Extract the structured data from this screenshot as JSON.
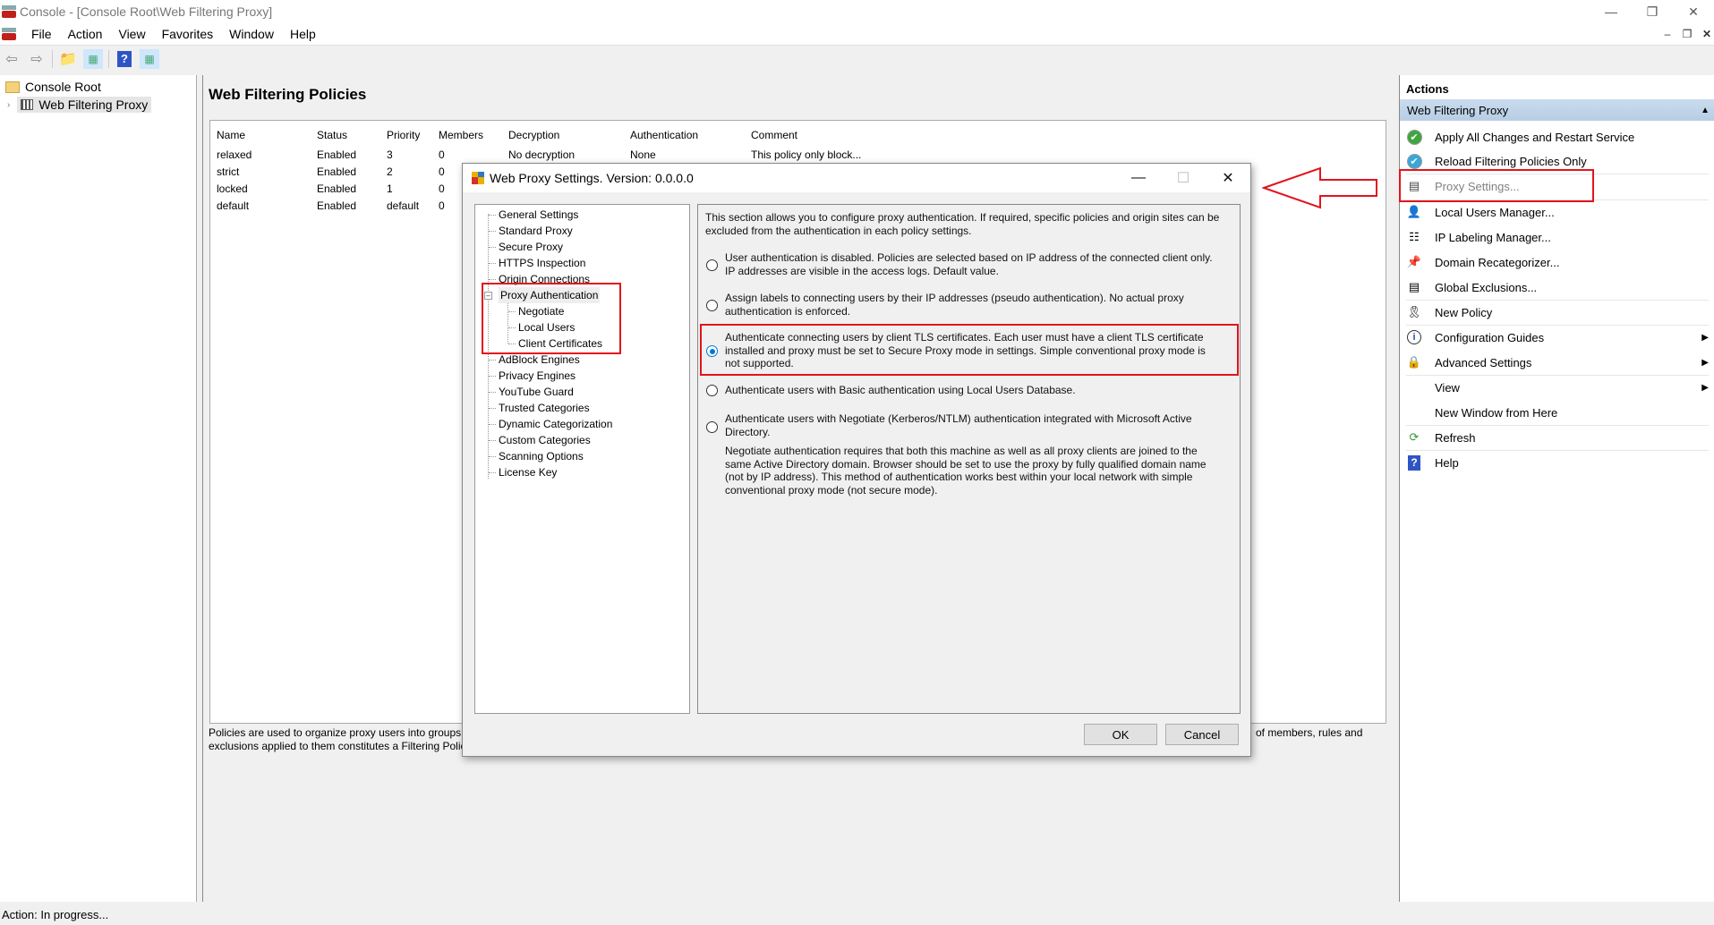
{
  "window": {
    "title": "Console - [Console Root\\Web Filtering Proxy]",
    "controls": [
      "minimize",
      "restore",
      "close"
    ]
  },
  "menu": {
    "items": [
      "File",
      "Action",
      "View",
      "Favorites",
      "Window",
      "Help"
    ]
  },
  "toolbar": {
    "buttons": [
      "back",
      "forward",
      "up-folder",
      "show-hide-console-tree",
      "help",
      "show-hide-action-pane"
    ]
  },
  "tree": {
    "root": "Console Root",
    "child": "Web Filtering Proxy"
  },
  "center": {
    "title": "Web Filtering Policies",
    "columns": [
      "Name",
      "Status",
      "Priority",
      "Members",
      "Decryption",
      "Authentication",
      "Comment"
    ],
    "rows": [
      [
        "relaxed",
        "Enabled",
        "3",
        "0",
        "No decryption",
        "None",
        "This policy only block..."
      ],
      [
        "strict",
        "Enabled",
        "2",
        "0",
        "",
        "",
        ""
      ],
      [
        "locked",
        "Enabled",
        "1",
        "0",
        "",
        "",
        ""
      ],
      [
        "default",
        "Enabled",
        "default",
        "0",
        "",
        "",
        ""
      ]
    ],
    "footer_left_line1": "Policies are used to organize proxy users into groups (",
    "footer_left_line2": "exclusions applied to them constitutes a Filtering Polic",
    "footer_right": "of members, rules and"
  },
  "actions": {
    "header": "Actions",
    "section": "Web Filtering Proxy",
    "items": [
      {
        "label": "Apply All Changes and Restart Service",
        "icon": "green-check-icon"
      },
      {
        "label": "Reload Filtering Policies Only",
        "icon": "blue-check-icon"
      },
      {
        "label": "Proxy Settings...",
        "icon": "settings-list-icon",
        "disabled": true
      },
      {
        "label": "Local Users Manager...",
        "icon": "user-icon"
      },
      {
        "label": "IP Labeling Manager...",
        "icon": "network-icon"
      },
      {
        "label": "Domain Recategorizer...",
        "icon": "pin-icon"
      },
      {
        "label": "Global Exclusions...",
        "icon": "exclusions-icon"
      },
      {
        "label": "New Policy",
        "icon": "ribbon-icon"
      },
      {
        "label": "Configuration Guides",
        "icon": "info-icon",
        "submenu": true
      },
      {
        "label": "Advanced Settings",
        "icon": "lock-icon",
        "submenu": true
      },
      {
        "label": "View",
        "icon": "",
        "submenu": true
      },
      {
        "label": "New Window from Here",
        "icon": ""
      },
      {
        "label": "Refresh",
        "icon": "refresh-icon"
      },
      {
        "label": "Help",
        "icon": "help-icon"
      }
    ]
  },
  "status": {
    "text": "Action:  In progress..."
  },
  "dialog": {
    "title": "Web Proxy Settings. Version: 0.0.0.0",
    "nav": [
      "General Settings",
      "Standard Proxy",
      "Secure Proxy",
      "HTTPS Inspection",
      "Origin Connections",
      "Proxy Authentication",
      "Negotiate",
      "Local Users",
      "Client Certificates",
      "AdBlock Engines",
      "Privacy Engines",
      "YouTube Guard",
      "Trusted Categories",
      "Dynamic Categorization",
      "Custom Categories",
      "Scanning Options",
      "License Key"
    ],
    "intro": "This section allows you to configure proxy authentication.  If required, specific policies and origin sites can be excluded from the authentication in each policy settings.",
    "options": [
      {
        "text": "User authentication is disabled. Policies are selected based on IP address of the connected client only. IP addresses are visible in the access logs. Default value.",
        "selected": false
      },
      {
        "text": "Assign labels to connecting users by their IP addresses (pseudo authentication). No actual proxy authentication is enforced.",
        "selected": false
      },
      {
        "text": "Authenticate connecting users by client TLS certificates. Each user must have a client TLS certificate installed and proxy must be set to Secure Proxy mode in settings. Simple conventional proxy mode is not supported.",
        "selected": true
      },
      {
        "text": "Authenticate users with Basic authentication using Local Users Database.",
        "selected": false
      },
      {
        "text": "Authenticate users with Negotiate (Kerberos/NTLM) authentication integrated with Microsoft Active Directory.",
        "selected": false
      }
    ],
    "negotiate_note": "Negotiate authentication requires that both this machine as well as all proxy clients are joined to the same Active Directory domain. Browser should be set to use the proxy by fully qualified domain name (not by IP address). This method of authentication works best within your local network with simple conventional proxy mode (not secure mode).",
    "ok_label": "OK",
    "cancel_label": "Cancel"
  },
  "colors": {
    "highlight_red": "#e3141c",
    "radio_selected": "#0078d7",
    "actions_section_bg": "#c3d7ec"
  }
}
